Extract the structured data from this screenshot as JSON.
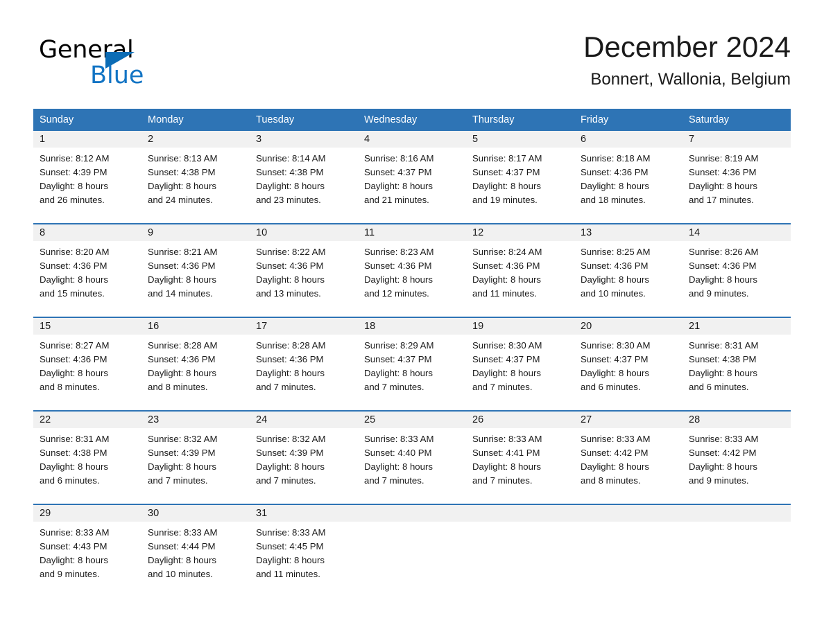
{
  "brand": {
    "name_part1": "General",
    "name_part2": "Blue",
    "accent_color": "#1274c4",
    "triangle_color": "#0b6cb5"
  },
  "header": {
    "month_title": "December 2024",
    "location": "Bonnert, Wallonia, Belgium"
  },
  "theme": {
    "header_bg": "#2e74b5",
    "daynum_bg": "#f1f1f1",
    "row_rule": "#2e74b5",
    "page_bg": "#ffffff",
    "text": "#1a1a1a"
  },
  "calendar": {
    "weekday_headers": [
      "Sunday",
      "Monday",
      "Tuesday",
      "Wednesday",
      "Thursday",
      "Friday",
      "Saturday"
    ],
    "weeks": [
      [
        {
          "day": "1",
          "sunrise": "Sunrise: 8:12 AM",
          "sunset": "Sunset: 4:39 PM",
          "daylight_1": "Daylight: 8 hours",
          "daylight_2": "and 26 minutes."
        },
        {
          "day": "2",
          "sunrise": "Sunrise: 8:13 AM",
          "sunset": "Sunset: 4:38 PM",
          "daylight_1": "Daylight: 8 hours",
          "daylight_2": "and 24 minutes."
        },
        {
          "day": "3",
          "sunrise": "Sunrise: 8:14 AM",
          "sunset": "Sunset: 4:38 PM",
          "daylight_1": "Daylight: 8 hours",
          "daylight_2": "and 23 minutes."
        },
        {
          "day": "4",
          "sunrise": "Sunrise: 8:16 AM",
          "sunset": "Sunset: 4:37 PM",
          "daylight_1": "Daylight: 8 hours",
          "daylight_2": "and 21 minutes."
        },
        {
          "day": "5",
          "sunrise": "Sunrise: 8:17 AM",
          "sunset": "Sunset: 4:37 PM",
          "daylight_1": "Daylight: 8 hours",
          "daylight_2": "and 19 minutes."
        },
        {
          "day": "6",
          "sunrise": "Sunrise: 8:18 AM",
          "sunset": "Sunset: 4:36 PM",
          "daylight_1": "Daylight: 8 hours",
          "daylight_2": "and 18 minutes."
        },
        {
          "day": "7",
          "sunrise": "Sunrise: 8:19 AM",
          "sunset": "Sunset: 4:36 PM",
          "daylight_1": "Daylight: 8 hours",
          "daylight_2": "and 17 minutes."
        }
      ],
      [
        {
          "day": "8",
          "sunrise": "Sunrise: 8:20 AM",
          "sunset": "Sunset: 4:36 PM",
          "daylight_1": "Daylight: 8 hours",
          "daylight_2": "and 15 minutes."
        },
        {
          "day": "9",
          "sunrise": "Sunrise: 8:21 AM",
          "sunset": "Sunset: 4:36 PM",
          "daylight_1": "Daylight: 8 hours",
          "daylight_2": "and 14 minutes."
        },
        {
          "day": "10",
          "sunrise": "Sunrise: 8:22 AM",
          "sunset": "Sunset: 4:36 PM",
          "daylight_1": "Daylight: 8 hours",
          "daylight_2": "and 13 minutes."
        },
        {
          "day": "11",
          "sunrise": "Sunrise: 8:23 AM",
          "sunset": "Sunset: 4:36 PM",
          "daylight_1": "Daylight: 8 hours",
          "daylight_2": "and 12 minutes."
        },
        {
          "day": "12",
          "sunrise": "Sunrise: 8:24 AM",
          "sunset": "Sunset: 4:36 PM",
          "daylight_1": "Daylight: 8 hours",
          "daylight_2": "and 11 minutes."
        },
        {
          "day": "13",
          "sunrise": "Sunrise: 8:25 AM",
          "sunset": "Sunset: 4:36 PM",
          "daylight_1": "Daylight: 8 hours",
          "daylight_2": "and 10 minutes."
        },
        {
          "day": "14",
          "sunrise": "Sunrise: 8:26 AM",
          "sunset": "Sunset: 4:36 PM",
          "daylight_1": "Daylight: 8 hours",
          "daylight_2": "and 9 minutes."
        }
      ],
      [
        {
          "day": "15",
          "sunrise": "Sunrise: 8:27 AM",
          "sunset": "Sunset: 4:36 PM",
          "daylight_1": "Daylight: 8 hours",
          "daylight_2": "and 8 minutes."
        },
        {
          "day": "16",
          "sunrise": "Sunrise: 8:28 AM",
          "sunset": "Sunset: 4:36 PM",
          "daylight_1": "Daylight: 8 hours",
          "daylight_2": "and 8 minutes."
        },
        {
          "day": "17",
          "sunrise": "Sunrise: 8:28 AM",
          "sunset": "Sunset: 4:36 PM",
          "daylight_1": "Daylight: 8 hours",
          "daylight_2": "and 7 minutes."
        },
        {
          "day": "18",
          "sunrise": "Sunrise: 8:29 AM",
          "sunset": "Sunset: 4:37 PM",
          "daylight_1": "Daylight: 8 hours",
          "daylight_2": "and 7 minutes."
        },
        {
          "day": "19",
          "sunrise": "Sunrise: 8:30 AM",
          "sunset": "Sunset: 4:37 PM",
          "daylight_1": "Daylight: 8 hours",
          "daylight_2": "and 7 minutes."
        },
        {
          "day": "20",
          "sunrise": "Sunrise: 8:30 AM",
          "sunset": "Sunset: 4:37 PM",
          "daylight_1": "Daylight: 8 hours",
          "daylight_2": "and 6 minutes."
        },
        {
          "day": "21",
          "sunrise": "Sunrise: 8:31 AM",
          "sunset": "Sunset: 4:38 PM",
          "daylight_1": "Daylight: 8 hours",
          "daylight_2": "and 6 minutes."
        }
      ],
      [
        {
          "day": "22",
          "sunrise": "Sunrise: 8:31 AM",
          "sunset": "Sunset: 4:38 PM",
          "daylight_1": "Daylight: 8 hours",
          "daylight_2": "and 6 minutes."
        },
        {
          "day": "23",
          "sunrise": "Sunrise: 8:32 AM",
          "sunset": "Sunset: 4:39 PM",
          "daylight_1": "Daylight: 8 hours",
          "daylight_2": "and 7 minutes."
        },
        {
          "day": "24",
          "sunrise": "Sunrise: 8:32 AM",
          "sunset": "Sunset: 4:39 PM",
          "daylight_1": "Daylight: 8 hours",
          "daylight_2": "and 7 minutes."
        },
        {
          "day": "25",
          "sunrise": "Sunrise: 8:33 AM",
          "sunset": "Sunset: 4:40 PM",
          "daylight_1": "Daylight: 8 hours",
          "daylight_2": "and 7 minutes."
        },
        {
          "day": "26",
          "sunrise": "Sunrise: 8:33 AM",
          "sunset": "Sunset: 4:41 PM",
          "daylight_1": "Daylight: 8 hours",
          "daylight_2": "and 7 minutes."
        },
        {
          "day": "27",
          "sunrise": "Sunrise: 8:33 AM",
          "sunset": "Sunset: 4:42 PM",
          "daylight_1": "Daylight: 8 hours",
          "daylight_2": "and 8 minutes."
        },
        {
          "day": "28",
          "sunrise": "Sunrise: 8:33 AM",
          "sunset": "Sunset: 4:42 PM",
          "daylight_1": "Daylight: 8 hours",
          "daylight_2": "and 9 minutes."
        }
      ],
      [
        {
          "day": "29",
          "sunrise": "Sunrise: 8:33 AM",
          "sunset": "Sunset: 4:43 PM",
          "daylight_1": "Daylight: 8 hours",
          "daylight_2": "and 9 minutes."
        },
        {
          "day": "30",
          "sunrise": "Sunrise: 8:33 AM",
          "sunset": "Sunset: 4:44 PM",
          "daylight_1": "Daylight: 8 hours",
          "daylight_2": "and 10 minutes."
        },
        {
          "day": "31",
          "sunrise": "Sunrise: 8:33 AM",
          "sunset": "Sunset: 4:45 PM",
          "daylight_1": "Daylight: 8 hours",
          "daylight_2": "and 11 minutes."
        },
        {
          "day": "",
          "sunrise": "",
          "sunset": "",
          "daylight_1": "",
          "daylight_2": ""
        },
        {
          "day": "",
          "sunrise": "",
          "sunset": "",
          "daylight_1": "",
          "daylight_2": ""
        },
        {
          "day": "",
          "sunrise": "",
          "sunset": "",
          "daylight_1": "",
          "daylight_2": ""
        },
        {
          "day": "",
          "sunrise": "",
          "sunset": "",
          "daylight_1": "",
          "daylight_2": ""
        }
      ]
    ]
  }
}
